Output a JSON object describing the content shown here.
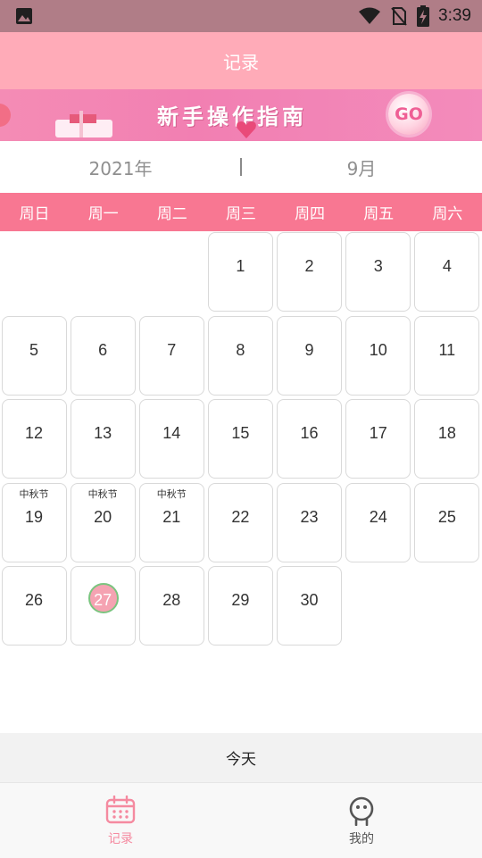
{
  "status_bar": {
    "time": "3:39",
    "icons": [
      "image-icon",
      "wifi-icon",
      "no-sim-icon",
      "battery-charging-icon"
    ]
  },
  "app_bar": {
    "title": "记录"
  },
  "banner": {
    "text": "新手操作指南",
    "go_label": "GO"
  },
  "date": {
    "year": "2021年",
    "month": "9月"
  },
  "weekdays": [
    "周日",
    "周一",
    "周二",
    "周三",
    "周四",
    "周五",
    "周六"
  ],
  "calendar": {
    "days": [
      {
        "day": "1",
        "festival": ""
      },
      {
        "day": "2",
        "festival": ""
      },
      {
        "day": "3",
        "festival": ""
      },
      {
        "day": "4",
        "festival": ""
      },
      {
        "day": "5",
        "festival": ""
      },
      {
        "day": "6",
        "festival": ""
      },
      {
        "day": "7",
        "festival": ""
      },
      {
        "day": "8",
        "festival": ""
      },
      {
        "day": "9",
        "festival": ""
      },
      {
        "day": "10",
        "festival": ""
      },
      {
        "day": "11",
        "festival": ""
      },
      {
        "day": "12",
        "festival": ""
      },
      {
        "day": "13",
        "festival": ""
      },
      {
        "day": "14",
        "festival": ""
      },
      {
        "day": "15",
        "festival": ""
      },
      {
        "day": "16",
        "festival": ""
      },
      {
        "day": "17",
        "festival": ""
      },
      {
        "day": "18",
        "festival": ""
      },
      {
        "day": "19",
        "festival": "中秋节"
      },
      {
        "day": "20",
        "festival": "中秋节"
      },
      {
        "day": "21",
        "festival": "中秋节"
      },
      {
        "day": "22",
        "festival": ""
      },
      {
        "day": "23",
        "festival": ""
      },
      {
        "day": "24",
        "festival": ""
      },
      {
        "day": "25",
        "festival": ""
      },
      {
        "day": "26",
        "festival": ""
      },
      {
        "day": "27",
        "festival": "",
        "today": true
      },
      {
        "day": "28",
        "festival": ""
      },
      {
        "day": "29",
        "festival": ""
      },
      {
        "day": "30",
        "festival": ""
      }
    ],
    "first_weekday": 3
  },
  "today_button": {
    "label": "今天"
  },
  "bottom_nav": {
    "items": [
      {
        "label": "记录",
        "icon": "calendar-icon",
        "active": true,
        "color": "#f58aa0"
      },
      {
        "label": "我的",
        "icon": "profile-face-icon",
        "active": false,
        "color": "#555555"
      }
    ]
  },
  "colors": {
    "status_bar": "#b07d87",
    "app_bar": "#ffabb8",
    "week_header": "#f87792",
    "accent": "#f58aa0",
    "today_border": "#7bc47f"
  }
}
